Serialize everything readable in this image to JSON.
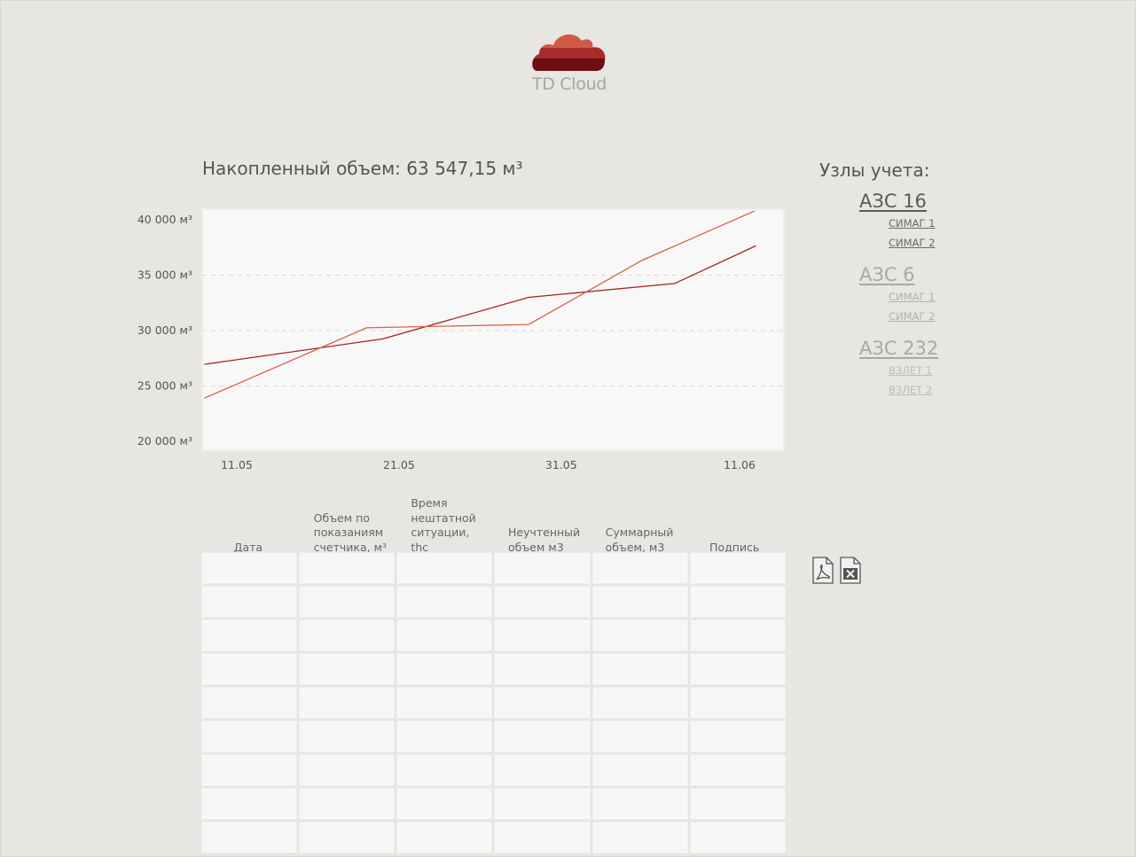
{
  "logo": {
    "text": "TD Cloud"
  },
  "summary": {
    "title": "Накопленный объем: 63 547,15 м³"
  },
  "nodes": {
    "title": "Узлы учета:",
    "groups": [
      {
        "name": "АЗС 16",
        "meters": [
          "СИМАГ 1",
          "СИМАГ 2"
        ]
      },
      {
        "name": "АЗС 6",
        "meters": [
          "СИМАГ 1",
          "СИМАГ 2"
        ]
      },
      {
        "name": "АЗС 232",
        "meters": [
          "ВЗЛЕТ 1",
          "ВЗЛЕТ 2"
        ]
      }
    ]
  },
  "table": {
    "headers": [
      "Дата",
      "Объем по показаниям счетчика, м³",
      "Время нештатной ситуации, thc",
      "Неучтенный объем м3",
      "Суммарный объем, м3",
      "Подпись"
    ],
    "rows": 9
  },
  "export": {
    "pdf_icon": "pdf-icon",
    "excel_icon": "excel-icon"
  },
  "colors": {
    "background": "#e7e6e3",
    "series_dark": "#a52424",
    "series_light": "#d6624a",
    "logo_light": "#d05a45",
    "logo_mid": "#a82b2b",
    "logo_dark": "#6e0d12"
  },
  "chart_data": {
    "type": "line",
    "y_tick_labels": [
      "40 000 м³",
      "35 000 м³",
      "30 000 м³",
      "25 000 м³",
      "20 000 м³"
    ],
    "y_ticks": [
      40000,
      35000,
      30000,
      25000,
      20000
    ],
    "x_tick_labels": [
      "11.05",
      "21.05",
      "31.05",
      "11.06"
    ],
    "ylim": [
      20000,
      40000
    ],
    "grid": "horizontal dashed",
    "series": [
      {
        "color": "#a52424",
        "x": [
          "09.05",
          "20.05",
          "29.05",
          "07.06",
          "12.06"
        ],
        "values": [
          26950,
          29250,
          33000,
          34250,
          37650
        ]
      },
      {
        "color": "#d6624a",
        "x": [
          "09.05",
          "19.05",
          "29.05",
          "05.06",
          "12.06"
        ],
        "values": [
          23900,
          30250,
          30550,
          36350,
          40850
        ]
      }
    ]
  }
}
